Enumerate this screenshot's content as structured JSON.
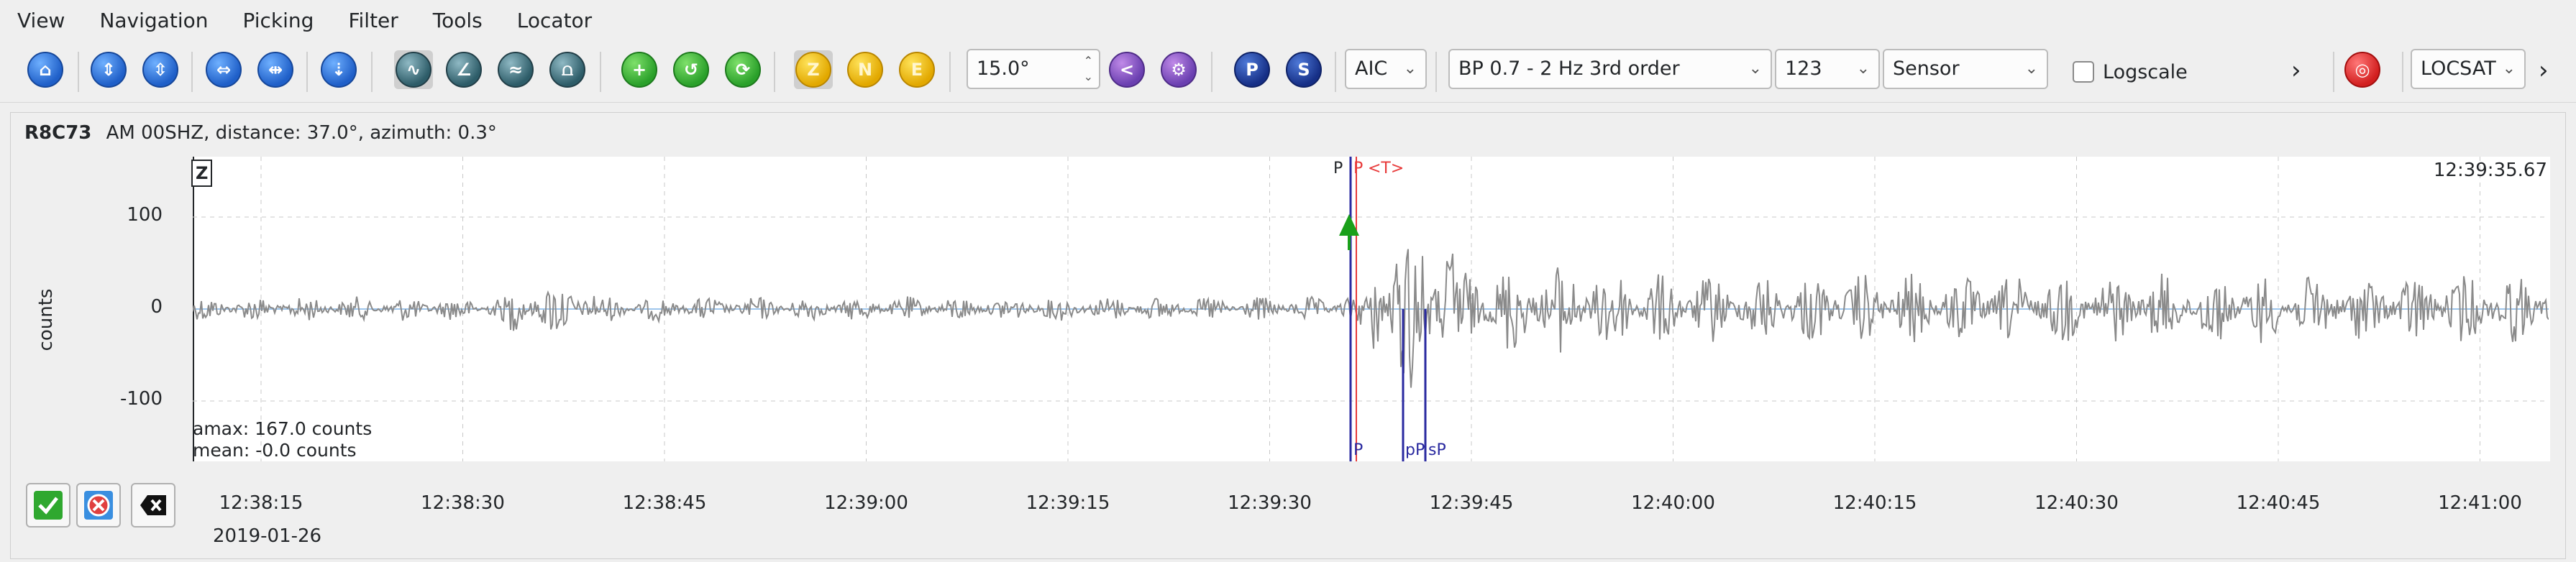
{
  "menu": [
    "View",
    "Navigation",
    "Picking",
    "Filter",
    "Tools",
    "Locator"
  ],
  "toolbar": {
    "incidence": "15.0°",
    "picker": "AIC",
    "filter": "BP 0.7 - 2 Hz  3rd order",
    "rotation": "123",
    "units": "Sensor",
    "logscale_label": "Logscale",
    "locator": "LOCSAT",
    "component_letters": [
      "Z",
      "N",
      "E"
    ],
    "phase_letters": [
      "P",
      "S"
    ],
    "more": "›"
  },
  "trace": {
    "station": "R8C73",
    "info": "AM  00SHZ, distance: 37.0°, azimuth: 0.3°",
    "component": "Z",
    "time_label": "12:39:35.67",
    "ylabel": "counts",
    "yticks": [
      "100",
      "0",
      "-100"
    ],
    "xticks": [
      "12:38:15",
      "12:38:30",
      "12:38:45",
      "12:39:00",
      "12:39:15",
      "12:39:30",
      "12:39:45",
      "12:40:00",
      "12:40:15",
      "12:40:30",
      "12:40:45",
      "12:41:00"
    ],
    "date": "2019-01-26",
    "amax": "amax: 167.0 counts",
    "mean": "mean: -0.0 counts",
    "picks_top": [
      "P",
      "P",
      "<T>"
    ],
    "picks_bottom": [
      "P",
      "pP",
      "sP"
    ]
  },
  "colors": {
    "trace": "#8a8a8a",
    "pick_red": "#e83a3a",
    "pick_blue": "#2a2aa0",
    "arrow_green": "#1aa01a",
    "zero_line": "#7fb2e5"
  }
}
